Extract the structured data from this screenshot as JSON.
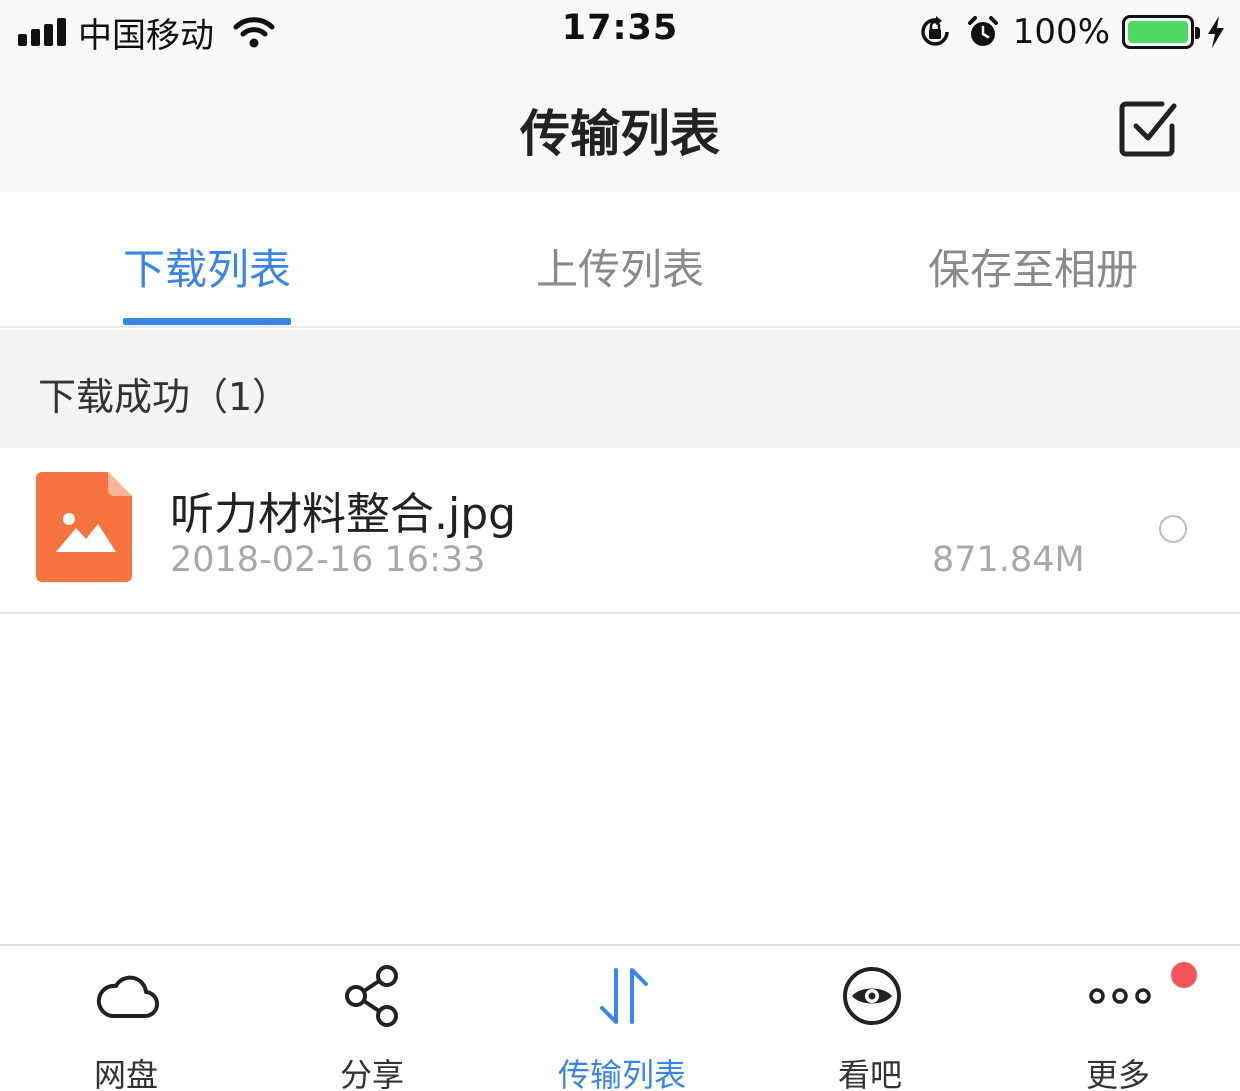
{
  "status_bar": {
    "carrier": "中国移动",
    "time": "17:35",
    "battery_percent": "100%",
    "battery_level": 1.0,
    "icons": [
      "signal-icon",
      "wifi-icon",
      "rotation-lock-icon",
      "alarm-icon",
      "battery-icon",
      "charging-bolt-icon"
    ]
  },
  "nav": {
    "title": "传输列表",
    "edit_icon": "checkbox-edit-icon"
  },
  "tabs": [
    {
      "label": "下载列表",
      "active": true
    },
    {
      "label": "上传列表",
      "active": false
    },
    {
      "label": "保存至相册",
      "active": false
    }
  ],
  "section": {
    "title": "下载成功（1）"
  },
  "files": [
    {
      "name": "听力材料整合.jpg",
      "date": "2018-02-16 16:33",
      "size": "871.84M",
      "icon": "image-file-icon",
      "selected": false
    }
  ],
  "tab_bar": {
    "items": [
      {
        "label": "网盘",
        "icon": "cloud-icon",
        "active": false
      },
      {
        "label": "分享",
        "icon": "share-icon",
        "active": false
      },
      {
        "label": "传输列表",
        "icon": "transfer-icon",
        "active": true
      },
      {
        "label": "看吧",
        "icon": "eye-icon",
        "active": false
      },
      {
        "label": "更多",
        "icon": "more-dots-icon",
        "active": false,
        "badge": true
      }
    ]
  },
  "colors": {
    "accent": "#3a86e8",
    "file_icon": "#f7733f",
    "badge": "#f0565a",
    "battery": "#4cd964"
  }
}
